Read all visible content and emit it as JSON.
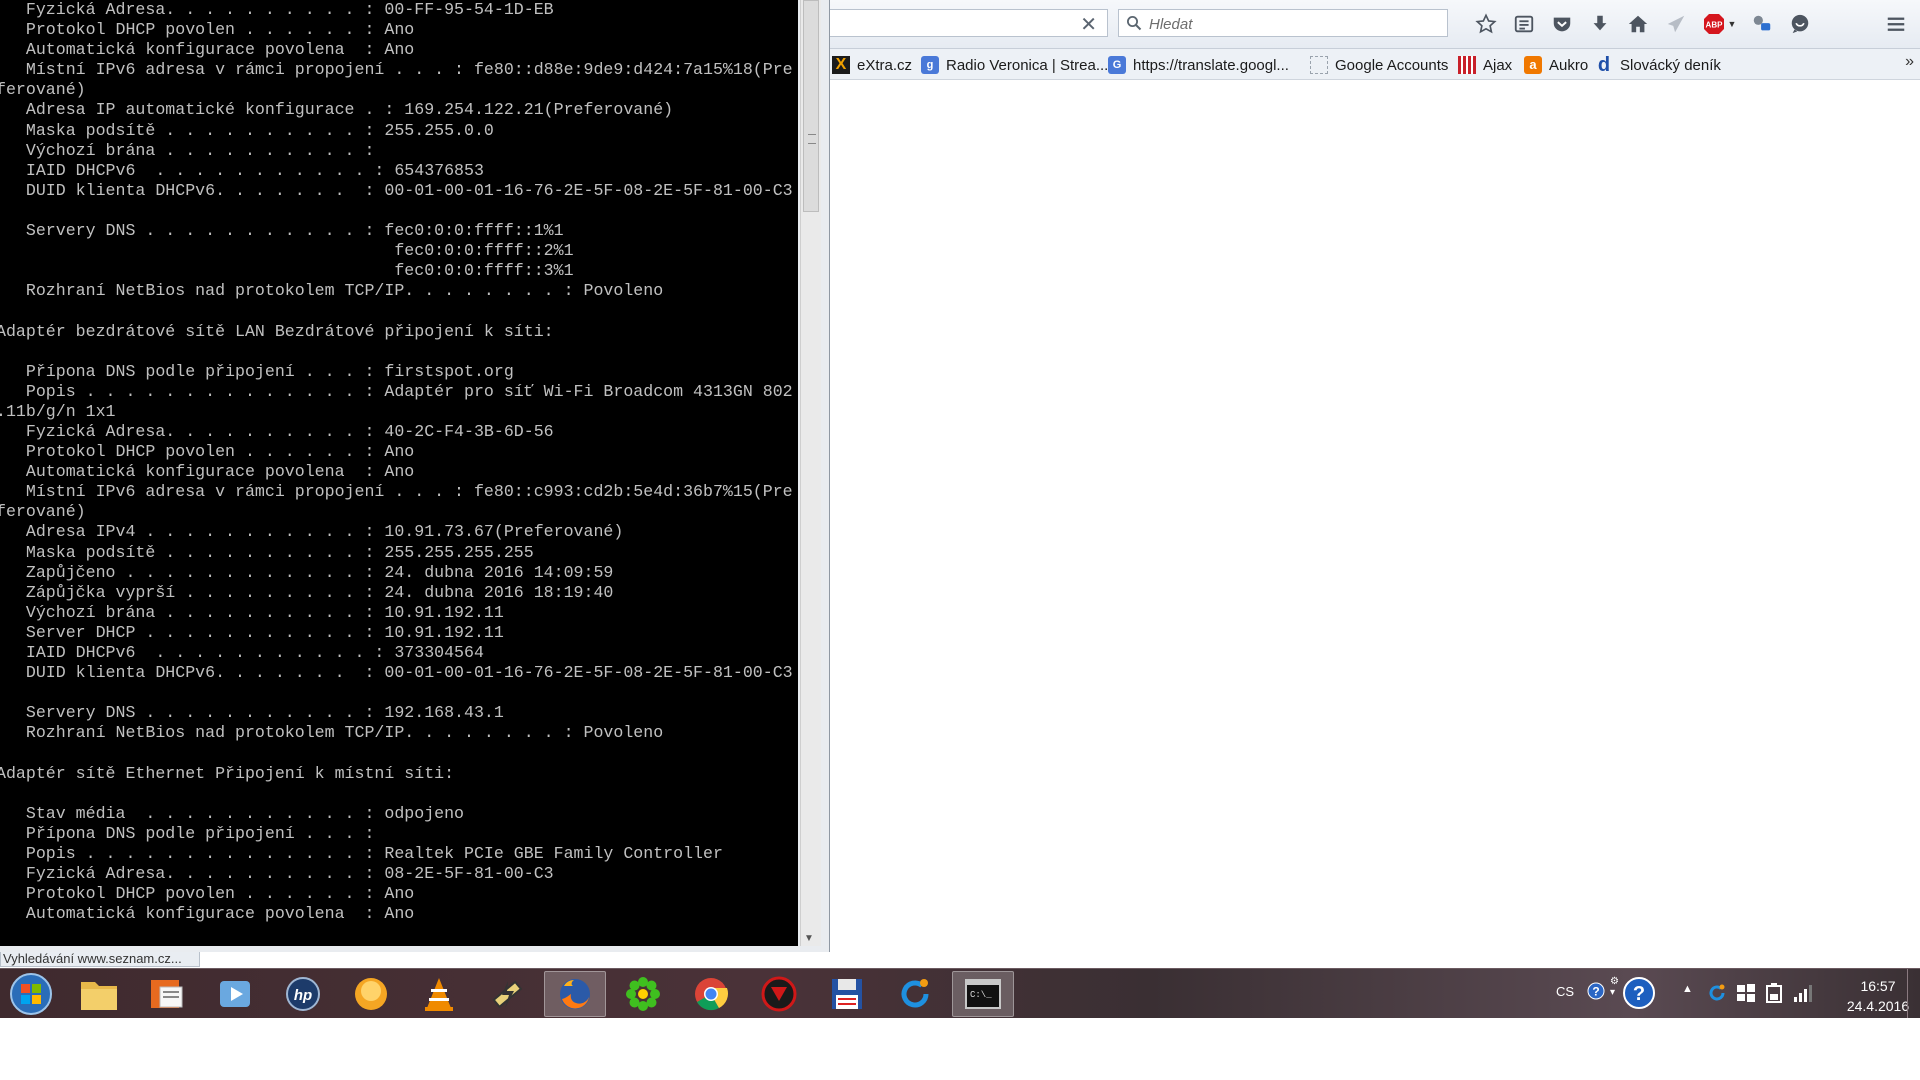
{
  "console": {
    "lines": [
      "   Fyzická Adresa. . . . . . . . . . : 00-FF-95-54-1D-EB",
      "   Protokol DHCP povolen . . . . . . : Ano",
      "   Automatická konfigurace povolena  : Ano",
      "   Místní IPv6 adresa v rámci propojení . . . : fe80::d88e:9de9:d424:7a15%18(Pre",
      "ferované)",
      "   Adresa IP automatické konfigurace . : 169.254.122.21(Preferované)",
      "   Maska podsítě . . . . . . . . . . : 255.255.0.0",
      "   Výchozí brána . . . . . . . . . . :",
      "   IAID DHCPv6  . . . . . . . . . . . : 654376853",
      "   DUID klienta DHCPv6. . . . . . .  : 00-01-00-01-16-76-2E-5F-08-2E-5F-81-00-C3",
      "",
      "   Servery DNS . . . . . . . . . . . : fec0:0:0:ffff::1%1",
      "                                        fec0:0:0:ffff::2%1",
      "                                        fec0:0:0:ffff::3%1",
      "   Rozhraní NetBios nad protokolem TCP/IP. . . . . . . . : Povoleno",
      "",
      "Adaptér bezdrátové sítě LAN Bezdrátové připojení k síti:",
      "",
      "   Přípona DNS podle připojení . . . : firstspot.org",
      "   Popis . . . . . . . . . . . . . . : Adaptér pro síť Wi-Fi Broadcom 4313GN 802",
      ".11b/g/n 1x1",
      "   Fyzická Adresa. . . . . . . . . . : 40-2C-F4-3B-6D-56",
      "   Protokol DHCP povolen . . . . . . : Ano",
      "   Automatická konfigurace povolena  : Ano",
      "   Místní IPv6 adresa v rámci propojení . . . : fe80::c993:cd2b:5e4d:36b7%15(Pre",
      "ferované)",
      "   Adresa IPv4 . . . . . . . . . . . : 10.91.73.67(Preferované)",
      "   Maska podsítě . . . . . . . . . . : 255.255.255.255",
      "   Zapůjčeno . . . . . . . . . . . . : 24. dubna 2016 14:09:59",
      "   Zápůjčka vyprší . . . . . . . . . : 24. dubna 2016 18:19:40",
      "   Výchozí brána . . . . . . . . . . : 10.91.192.11",
      "   Server DHCP . . . . . . . . . . . : 10.91.192.11",
      "   IAID DHCPv6  . . . . . . . . . . . : 373304564",
      "   DUID klienta DHCPv6. . . . . . .  : 00-01-00-01-16-76-2E-5F-08-2E-5F-81-00-C3",
      "",
      "   Servery DNS . . . . . . . . . . . : 192.168.43.1",
      "   Rozhraní NetBios nad protokolem TCP/IP. . . . . . . . : Povoleno",
      "",
      "Adaptér sítě Ethernet Připojení k místní síti:",
      "",
      "   Stav média  . . . . . . . . . . . : odpojeno",
      "   Přípona DNS podle připojení . . . :",
      "   Popis . . . . . . . . . . . . . . : Realtek PCIe GBE Family Controller",
      "   Fyzická Adresa. . . . . . . . . . : 08-2E-5F-81-00-C3",
      "   Protokol DHCP povolen . . . . . . : Ano",
      "   Automatická konfigurace povolena  : Ano"
    ]
  },
  "browser": {
    "search_placeholder": "Hledat",
    "url_clear_glyph": "✕",
    "status_text": "Vyhledávání www.seznam.cz...",
    "bookmarks_overflow": "»",
    "bookmarks": [
      {
        "label": "eXtra.cz",
        "icon": "extra-icon",
        "color": "#f0a000"
      },
      {
        "label": "Radio Veronica | Strea...",
        "icon": "radio-icon",
        "color": "#4a79d8"
      },
      {
        "label": "https://translate.googl...",
        "icon": "translate-icon",
        "color": "#4a79d8"
      },
      {
        "label": "Google Accounts",
        "icon": "page-icon",
        "color": "#9aa3ad"
      },
      {
        "label": "Ajax",
        "icon": "ajax-icon",
        "color": "#c8202a"
      },
      {
        "label": "Aukro",
        "icon": "aukro-icon",
        "color": "#f07800"
      },
      {
        "label": "Slovácký deník",
        "icon": "denik-icon",
        "color": "#1f4fa8"
      }
    ],
    "toolbar_icons": [
      "star-icon",
      "reading-list-icon",
      "pocket-icon",
      "download-icon",
      "home-icon",
      "send-icon",
      "adblock-icon",
      "extension-icon",
      "chat-icon",
      "menu-icon"
    ],
    "adblock_label": "ABP"
  },
  "taskbar": {
    "apps": [
      "start-orb",
      "explorer",
      "office",
      "media-player",
      "hp-tool",
      "messenger",
      "vlc",
      "tool",
      "firefox",
      "icq",
      "chrome",
      "game",
      "floppy-save",
      "refresh-app",
      "cmd"
    ],
    "active_app": "firefox",
    "language": "CS",
    "clock_time": "16:57",
    "clock_date": "24.4.2016"
  }
}
